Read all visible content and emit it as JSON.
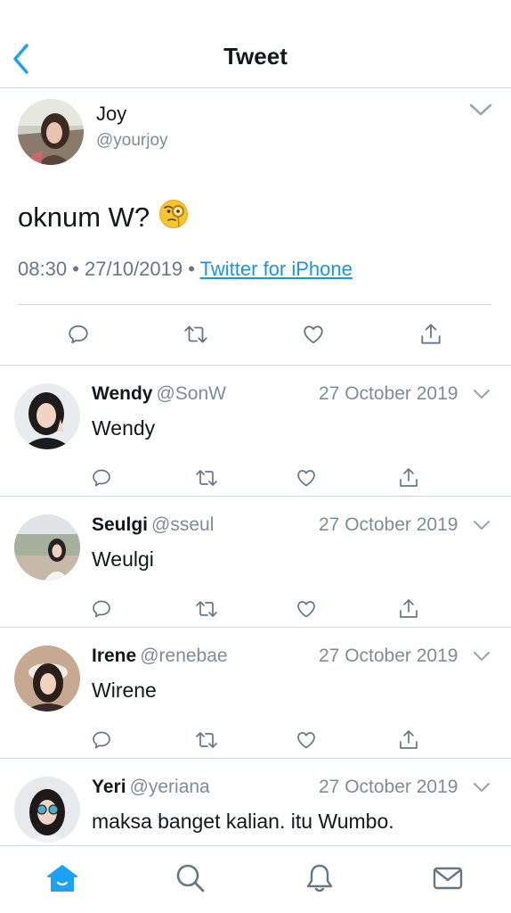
{
  "header": {
    "title": "Tweet"
  },
  "main_tweet": {
    "name": "Joy",
    "handle": "@yourjoy",
    "text": "oknum W?",
    "emoji": "🧐",
    "time": "08:30",
    "date": "27/10/2019",
    "source": "Twitter for iPhone"
  },
  "replies": [
    {
      "name": "Wendy",
      "handle": "@SonW",
      "date": "27 October 2019",
      "text": "Wendy"
    },
    {
      "name": "Seulgi",
      "handle": "@sseul",
      "date": "27 October 2019",
      "text": "Weulgi"
    },
    {
      "name": "Irene",
      "handle": "@renebae",
      "date": "27 October 2019",
      "text": "Wirene"
    },
    {
      "name": "Yeri",
      "handle": "@yeriana",
      "date": "27 October 2019",
      "text": "maksa banget kalian. itu Wumbo."
    }
  ],
  "colors": {
    "accent": "#1da1f2",
    "link": "#1b95e0",
    "secondary_text": "#657786",
    "icon": "#657786"
  },
  "tabbar": {
    "icons": [
      "home-icon",
      "search-icon",
      "notifications-icon",
      "messages-icon"
    ],
    "active": "home-icon"
  }
}
